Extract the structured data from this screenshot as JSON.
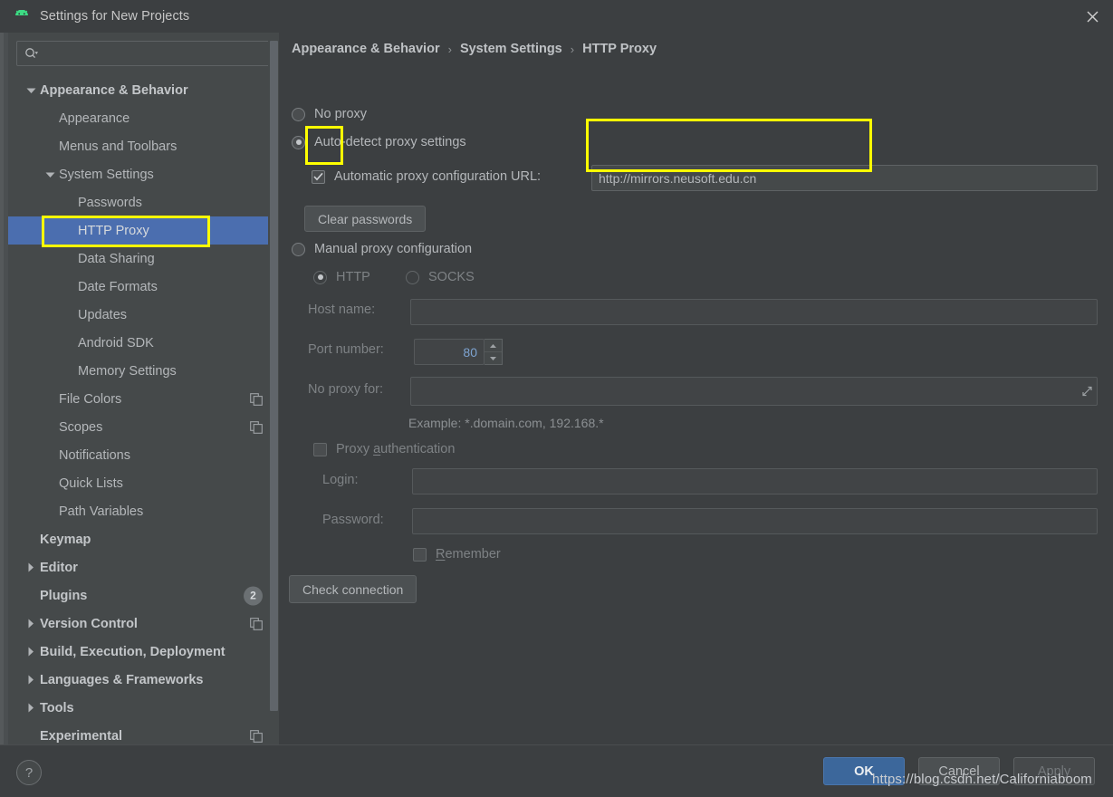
{
  "window": {
    "title": "Settings for New Projects",
    "app_icon": "android-icon",
    "close_icon": "close-icon"
  },
  "sidebar": {
    "search": {
      "placeholder": "",
      "value": "",
      "icon": "search-icon"
    },
    "items": [
      {
        "label": "Appearance & Behavior",
        "indent": 0,
        "arrow": "down",
        "bold": true,
        "selected": false
      },
      {
        "label": "Appearance",
        "indent": 1,
        "arrow": "none",
        "bold": false,
        "selected": false
      },
      {
        "label": "Menus and Toolbars",
        "indent": 1,
        "arrow": "none",
        "bold": false,
        "selected": false
      },
      {
        "label": "System Settings",
        "indent": 1,
        "arrow": "down",
        "bold": false,
        "selected": false
      },
      {
        "label": "Passwords",
        "indent": 2,
        "arrow": "none",
        "bold": false,
        "selected": false
      },
      {
        "label": "HTTP Proxy",
        "indent": 2,
        "arrow": "none",
        "bold": false,
        "selected": true
      },
      {
        "label": "Data Sharing",
        "indent": 2,
        "arrow": "none",
        "bold": false,
        "selected": false
      },
      {
        "label": "Date Formats",
        "indent": 2,
        "arrow": "none",
        "bold": false,
        "selected": false
      },
      {
        "label": "Updates",
        "indent": 2,
        "arrow": "none",
        "bold": false,
        "selected": false
      },
      {
        "label": "Android SDK",
        "indent": 2,
        "arrow": "none",
        "bold": false,
        "selected": false
      },
      {
        "label": "Memory Settings",
        "indent": 2,
        "arrow": "none",
        "bold": false,
        "selected": false
      },
      {
        "label": "File Colors",
        "indent": 1,
        "arrow": "none",
        "bold": false,
        "selected": false,
        "icon": "copy-icon"
      },
      {
        "label": "Scopes",
        "indent": 1,
        "arrow": "none",
        "bold": false,
        "selected": false,
        "icon": "copy-icon"
      },
      {
        "label": "Notifications",
        "indent": 1,
        "arrow": "none",
        "bold": false,
        "selected": false
      },
      {
        "label": "Quick Lists",
        "indent": 1,
        "arrow": "none",
        "bold": false,
        "selected": false
      },
      {
        "label": "Path Variables",
        "indent": 1,
        "arrow": "none",
        "bold": false,
        "selected": false
      },
      {
        "label": "Keymap",
        "indent": 0,
        "arrow": "none",
        "bold": true,
        "selected": false
      },
      {
        "label": "Editor",
        "indent": 0,
        "arrow": "right",
        "bold": true,
        "selected": false
      },
      {
        "label": "Plugins",
        "indent": 0,
        "arrow": "none",
        "bold": true,
        "selected": false,
        "badge": "2"
      },
      {
        "label": "Version Control",
        "indent": 0,
        "arrow": "right",
        "bold": true,
        "selected": false,
        "icon": "copy-icon"
      },
      {
        "label": "Build, Execution, Deployment",
        "indent": 0,
        "arrow": "right",
        "bold": true,
        "selected": false
      },
      {
        "label": "Languages & Frameworks",
        "indent": 0,
        "arrow": "right",
        "bold": true,
        "selected": false
      },
      {
        "label": "Tools",
        "indent": 0,
        "arrow": "right",
        "bold": true,
        "selected": false
      },
      {
        "label": "Experimental",
        "indent": 0,
        "arrow": "none",
        "bold": true,
        "selected": false,
        "icon": "copy-icon"
      }
    ]
  },
  "breadcrumb": {
    "part1": "Appearance & Behavior",
    "sep1": "›",
    "part2": "System Settings",
    "sep2": "›",
    "part3": "HTTP Proxy"
  },
  "proxy": {
    "no_proxy_label": "No proxy",
    "no_proxy_selected": false,
    "auto_detect_label": "Auto-detect proxy settings",
    "auto_detect_selected": true,
    "auto_url_label": "Automatic proxy configuration URL:",
    "auto_url_checked": true,
    "auto_url_value": "http://mirrors.neusoft.edu.cn",
    "clear_passwords_label": "Clear passwords",
    "manual_label": "Manual proxy configuration",
    "manual_selected": false,
    "http_label": "HTTP",
    "http_selected": true,
    "socks_label": "SOCKS",
    "socks_selected": false,
    "host_name_label": "Host name:",
    "host_name_value": "",
    "port_number_label": "Port number:",
    "port_number_value": "80",
    "no_proxy_for_label": "No proxy for:",
    "no_proxy_for_value": "",
    "example_hint": "Example: *.domain.com, 192.168.*",
    "proxy_auth_label_pre": "Proxy ",
    "proxy_auth_label_mnem": "a",
    "proxy_auth_label_post": "uthentication",
    "proxy_auth_checked": false,
    "login_label": "Login:",
    "login_value": "",
    "password_label": "Password:",
    "password_value": "",
    "remember_label_mnem": "R",
    "remember_label_post": "emember",
    "remember_checked": false,
    "check_connection_label": "Check connection"
  },
  "footer": {
    "help_label": "?",
    "ok_label": "OK",
    "cancel_label": "Cancel",
    "apply_label": "Apply"
  },
  "watermark": "https://blog.csdn.net/Californiaboom",
  "colors": {
    "selection_blue": "#4b6eaf",
    "primary_button": "#3c679b",
    "annotation_yellow": "#ffff00",
    "panel_bg": "#3c3f41",
    "sidebar_bg": "#45494a",
    "text": "#b4b7ba"
  }
}
